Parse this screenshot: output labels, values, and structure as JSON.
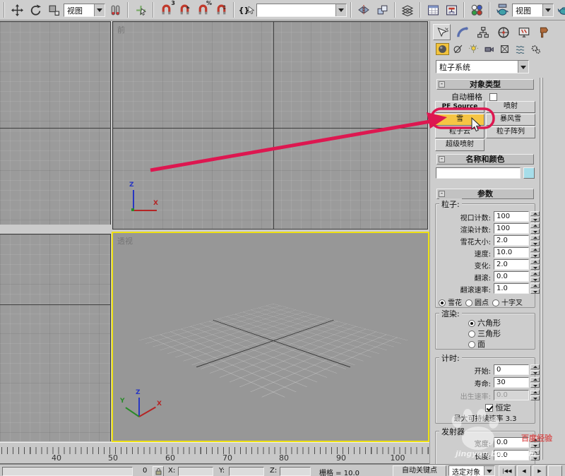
{
  "toolbar": {
    "ref_coord_dropdown": "视图",
    "named_sel_dropdown": "",
    "render_view_dropdown": "视图",
    "snap_badge_3": "3",
    "snap_badge_pct": "%",
    "named_sets_glyph": "{}"
  },
  "viewports": {
    "front_label": "前",
    "perspective_label": "透视",
    "axis": {
      "x": "X",
      "y": "Y",
      "z": "Z"
    }
  },
  "command_panel": {
    "category_dropdown": "粒子系统",
    "object_type": {
      "title": "对象类型",
      "autogrid": "自动栅格",
      "btn_pf_source": "PF Source",
      "btn_spray": "喷射",
      "btn_snow": "雪",
      "btn_blizzard": "暴风雪",
      "btn_pcloud": "粒子云",
      "btn_parray": "粒子阵列",
      "btn_super_spray": "超级喷射"
    },
    "name_color": {
      "title": "名称和颜色",
      "name_value": ""
    },
    "parameters": {
      "title": "参数",
      "particles": {
        "label": "粒子:",
        "rows": [
          {
            "label": "视口计数:",
            "value": "100"
          },
          {
            "label": "渲染计数:",
            "value": "100"
          },
          {
            "label": "雪花大小:",
            "value": "2.0"
          },
          {
            "label": "速度:",
            "value": "10.0"
          },
          {
            "label": "变化:",
            "value": "2.0"
          },
          {
            "label": "翻滚:",
            "value": "0.0"
          },
          {
            "label": "翻滚速率:",
            "value": "1.0"
          }
        ],
        "shapes": [
          {
            "label": "雪花",
            "selected": true
          },
          {
            "label": "圆点",
            "selected": false
          },
          {
            "label": "十字叉",
            "selected": false
          }
        ]
      },
      "render": {
        "label": "渲染:",
        "options": [
          {
            "label": "六角形",
            "selected": true
          },
          {
            "label": "三角形",
            "selected": false
          },
          {
            "label": "面",
            "selected": false
          }
        ]
      },
      "timing": {
        "label": "计时:",
        "rows": [
          {
            "label": "开始:",
            "value": "0"
          },
          {
            "label": "寿命:",
            "value": "30"
          },
          {
            "label": "出生速率:",
            "value": "0.0",
            "disabled": true
          }
        ],
        "constant": "恒定",
        "max_rate": "最大可持续速率 3.3"
      }
    },
    "emitter": {
      "title": "发射器",
      "rows": [
        {
          "label": "宽度:",
          "value": "0.0"
        },
        {
          "label": "长度:",
          "value": "0.0"
        }
      ]
    }
  },
  "timeline": {
    "ticks": [
      "40",
      "50",
      "60",
      "70",
      "80",
      "90",
      "100"
    ]
  },
  "status_bar": {
    "frame": "0",
    "x_label": "X:",
    "y_label": "Y:",
    "z_label": "Z:",
    "grid_info": "栅格 = 10.0",
    "auto_key": "自动关键点",
    "selection_filter": "选定对象",
    "transport": [
      "|◀◀",
      "◀",
      "▶"
    ]
  },
  "watermark": {
    "site": "jingyan.baidu.com",
    "logo": "百度经验"
  },
  "ui": {
    "minus": "-"
  },
  "colors": {
    "accent_red": "#dd1750",
    "snow_button": "#f6c544",
    "active_border": "#eee112",
    "name_swatch": "#a6dde9"
  }
}
